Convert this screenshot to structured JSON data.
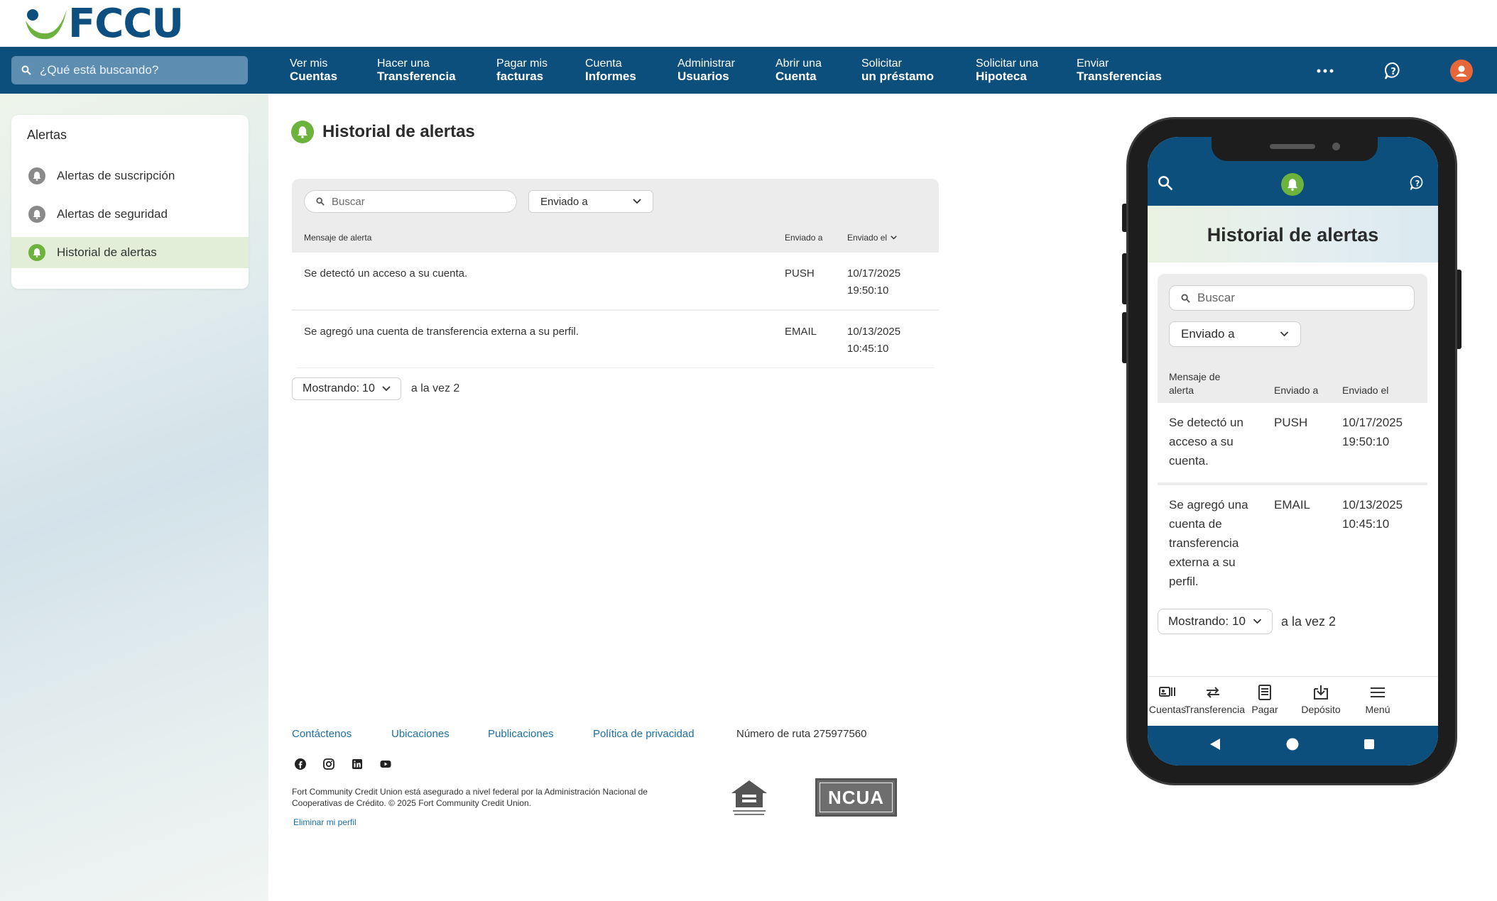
{
  "brand": {
    "name": "FCCU",
    "primary": "#0c4f7c",
    "accent_green": "#6cb33e"
  },
  "header": {
    "search_placeholder": "¿Qué está buscando?",
    "nav": [
      {
        "line1": "Ver mis",
        "line2": "Cuentas"
      },
      {
        "line1": "Hacer una",
        "line2": "Transferencia"
      },
      {
        "line1": "Pagar mis",
        "line2": "facturas"
      },
      {
        "line1": "Cuenta",
        "line2": "Informes"
      },
      {
        "line1": "Administrar",
        "line2": "Usuarios"
      },
      {
        "line1": "Abrir una",
        "line2": "Cuenta"
      },
      {
        "line1": "Solicitar",
        "line2": "un préstamo"
      },
      {
        "line1": "Solicitar una",
        "line2": "Hipoteca"
      },
      {
        "line1": "Enviar",
        "line2": "Transferencias"
      }
    ],
    "icons": [
      "more-icon",
      "help-chat-icon",
      "user-avatar-icon"
    ]
  },
  "sidebar": {
    "title": "Alertas",
    "items": [
      {
        "label": "Alertas de suscripción",
        "icon": "bell-icon",
        "active": false
      },
      {
        "label": "Alertas de seguridad",
        "icon": "bell-icon",
        "active": false
      },
      {
        "label": "Historial de alertas",
        "icon": "bell-icon",
        "active": true
      }
    ]
  },
  "main": {
    "title": "Historial de alertas",
    "search_placeholder": "Buscar",
    "filter_label": "Enviado a",
    "columns": [
      "Mensaje de alerta",
      "Enviado a",
      "Enviado el"
    ],
    "rows": [
      {
        "message": "Se detectó un acceso a su cuenta.",
        "sent_to": "PUSH",
        "date": "10/17/2025",
        "time": "19:50:10"
      },
      {
        "message": "Se agregó una cuenta de transferencia externa a su perfil.",
        "sent_to": "EMAIL",
        "date": "10/13/2025",
        "time": "10:45:10"
      }
    ],
    "paging": {
      "label": "Mostrando:",
      "value": "10",
      "after": "a la vez 2"
    }
  },
  "footer": {
    "links": [
      "Contáctenos",
      "Ubicaciones",
      "Publicaciones",
      "Política de privacidad"
    ],
    "routing": "Número de ruta 275977560",
    "social": [
      "facebook-icon",
      "instagram-icon",
      "linkedin-icon",
      "youtube-icon"
    ],
    "legal": "Fort Community Credit Union está asegurado a nivel federal por la Administración Nacional de Cooperativas de Crédito. © 2025 Fort Community Credit Union.",
    "delete_profile": "Eliminar mi perfil",
    "ncua": "NCUA"
  },
  "mobile": {
    "title": "Historial de alertas",
    "search_placeholder": "Buscar",
    "filter_label": "Enviado a",
    "col_message_l1": "Mensaje de",
    "col_message_l2": "alerta",
    "col_sent_to": "Enviado a",
    "col_sent_on": "Enviado el",
    "rows": [
      {
        "lines": [
          "Se detectó un",
          "acceso a su",
          "cuenta."
        ],
        "sent_to": "PUSH",
        "date": "10/17/2025",
        "time": "19:50:10"
      },
      {
        "lines": [
          "Se agregó una",
          "cuenta de",
          "transferencia",
          "externa a su",
          "perfil."
        ],
        "sent_to": "EMAIL",
        "date": "10/13/2025",
        "time": "10:45:10"
      }
    ],
    "paging": {
      "label": "Mostrando:",
      "value": "10",
      "after": "a la vez 2"
    },
    "tabs": [
      {
        "label": "Cuentas",
        "icon": "accounts-icon"
      },
      {
        "label": "Transferencia",
        "icon": "transfer-icon"
      },
      {
        "label": "Pagar",
        "icon": "pay-icon"
      },
      {
        "label": "Depósito",
        "icon": "deposit-icon"
      },
      {
        "label": "Menú",
        "icon": "menu-icon"
      }
    ]
  }
}
